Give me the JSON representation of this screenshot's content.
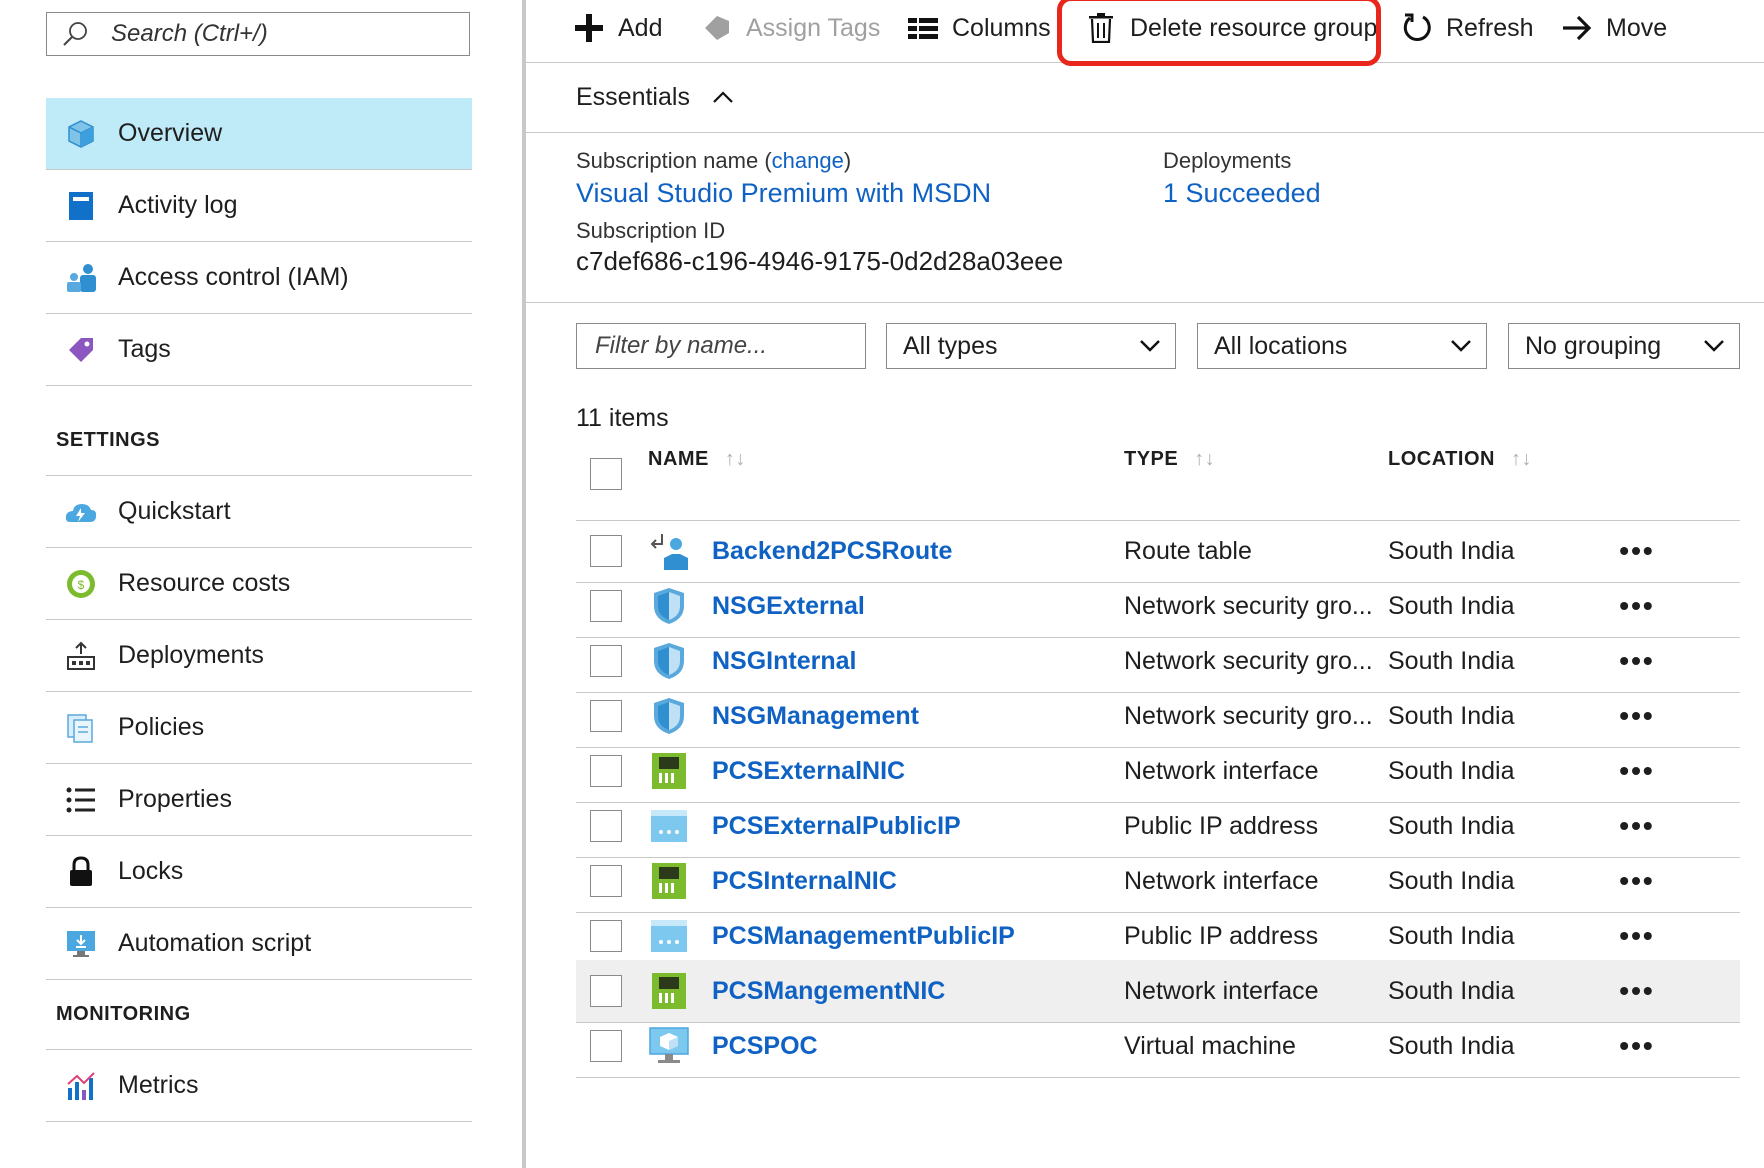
{
  "sidebar": {
    "search_placeholder": "Search (Ctrl+/)",
    "items": [
      {
        "label": "Overview",
        "icon": "cube-icon",
        "active": true
      },
      {
        "label": "Activity log",
        "icon": "log-icon"
      },
      {
        "label": "Access control (IAM)",
        "icon": "people-icon"
      },
      {
        "label": "Tags",
        "icon": "tag-icon"
      }
    ],
    "sections": [
      {
        "title": "SETTINGS",
        "items": [
          {
            "label": "Quickstart",
            "icon": "cloud-bolt-icon"
          },
          {
            "label": "Resource costs",
            "icon": "cost-icon"
          },
          {
            "label": "Deployments",
            "icon": "deployments-icon"
          },
          {
            "label": "Policies",
            "icon": "policies-icon"
          },
          {
            "label": "Properties",
            "icon": "properties-icon"
          },
          {
            "label": "Locks",
            "icon": "lock-icon"
          },
          {
            "label": "Automation script",
            "icon": "monitor-download-icon"
          }
        ]
      },
      {
        "title": "MONITORING",
        "items": [
          {
            "label": "Metrics",
            "icon": "metrics-icon"
          }
        ]
      }
    ]
  },
  "toolbar": {
    "add": "Add",
    "assign_tags": "Assign Tags",
    "columns": "Columns",
    "delete_group": "Delete resource group",
    "refresh": "Refresh",
    "move": "Move"
  },
  "essentials": {
    "title": "Essentials",
    "subscription_name_label": "Subscription name",
    "change_link": "change",
    "subscription_name": "Visual Studio Premium with MSDN",
    "subscription_id_label": "Subscription ID",
    "subscription_id": "c7def686-c196-4946-9175-0d2d28a03eee",
    "deployments_label": "Deployments",
    "deployments_value": "1 Succeeded"
  },
  "filters": {
    "name_placeholder": "Filter by name...",
    "types": "All types",
    "locations": "All locations",
    "grouping": "No grouping"
  },
  "items_count": "11 items",
  "table": {
    "headers": {
      "name": "NAME",
      "type": "TYPE",
      "location": "LOCATION"
    },
    "sort_glyph": "↑↓",
    "more_glyph": "•••",
    "rows": [
      {
        "name": "Backend2PCSRoute",
        "type": "Route table",
        "location": "South India",
        "icon": "route-table-icon"
      },
      {
        "name": "NSGExternal",
        "type": "Network security gro...",
        "location": "South India",
        "icon": "shield-icon"
      },
      {
        "name": "NSGInternal",
        "type": "Network security gro...",
        "location": "South India",
        "icon": "shield-icon"
      },
      {
        "name": "NSGManagement",
        "type": "Network security gro...",
        "location": "South India",
        "icon": "shield-icon"
      },
      {
        "name": "PCSExternalNIC",
        "type": "Network interface",
        "location": "South India",
        "icon": "nic-icon"
      },
      {
        "name": "PCSExternalPublicIP",
        "type": "Public IP address",
        "location": "South India",
        "icon": "public-ip-icon"
      },
      {
        "name": "PCSInternalNIC",
        "type": "Network interface",
        "location": "South India",
        "icon": "nic-icon"
      },
      {
        "name": "PCSManagementPublicIP",
        "type": "Public IP address",
        "location": "South India",
        "icon": "public-ip-icon"
      },
      {
        "name": "PCSMangementNIC",
        "type": "Network interface",
        "location": "South India",
        "icon": "nic-icon",
        "hover": true
      },
      {
        "name": "PCSPOC",
        "type": "Virtual machine",
        "location": "South India",
        "icon": "vm-icon"
      }
    ]
  },
  "colors": {
    "accent_link": "#0f62c3",
    "active_nav_bg": "#bfeaf7",
    "highlight_red": "#e8261c"
  }
}
